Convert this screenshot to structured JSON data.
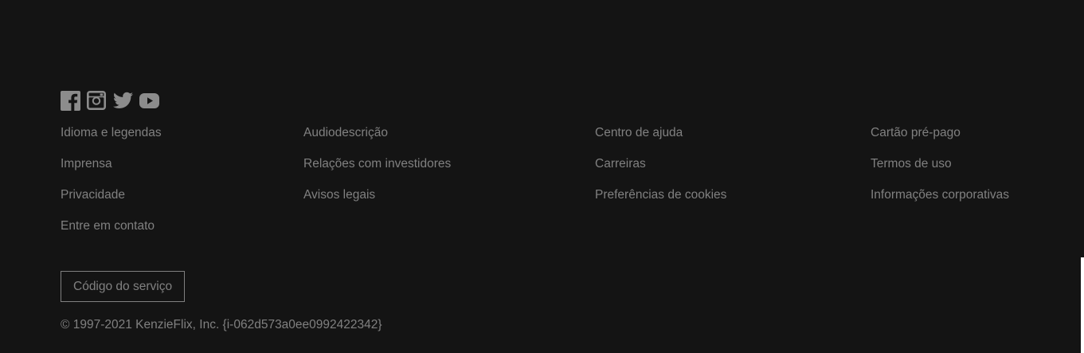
{
  "social": [
    {
      "name": "facebook",
      "icon": "facebook-icon"
    },
    {
      "name": "instagram",
      "icon": "instagram-icon"
    },
    {
      "name": "twitter",
      "icon": "twitter-icon"
    },
    {
      "name": "youtube",
      "icon": "youtube-icon"
    }
  ],
  "links": {
    "col1": [
      "Idioma e legendas",
      "Imprensa",
      "Privacidade",
      "Entre em contato"
    ],
    "col2": [
      "Audiodescrição",
      "Relações com investidores",
      "Avisos legais"
    ],
    "col3": [
      "Centro de ajuda",
      "Carreiras",
      "Preferências de cookies"
    ],
    "col4": [
      "Cartão pré-pago",
      "Termos de uso",
      "Informações corporativas"
    ]
  },
  "service_code_button": "Código do serviço",
  "copyright": "© 1997-2021 KenzieFlix, Inc. {i-062d573a0ee0992422342}",
  "colors": {
    "background": "#141414",
    "text": "#808080",
    "icon": "#8c8c8c",
    "border": "#808080"
  }
}
